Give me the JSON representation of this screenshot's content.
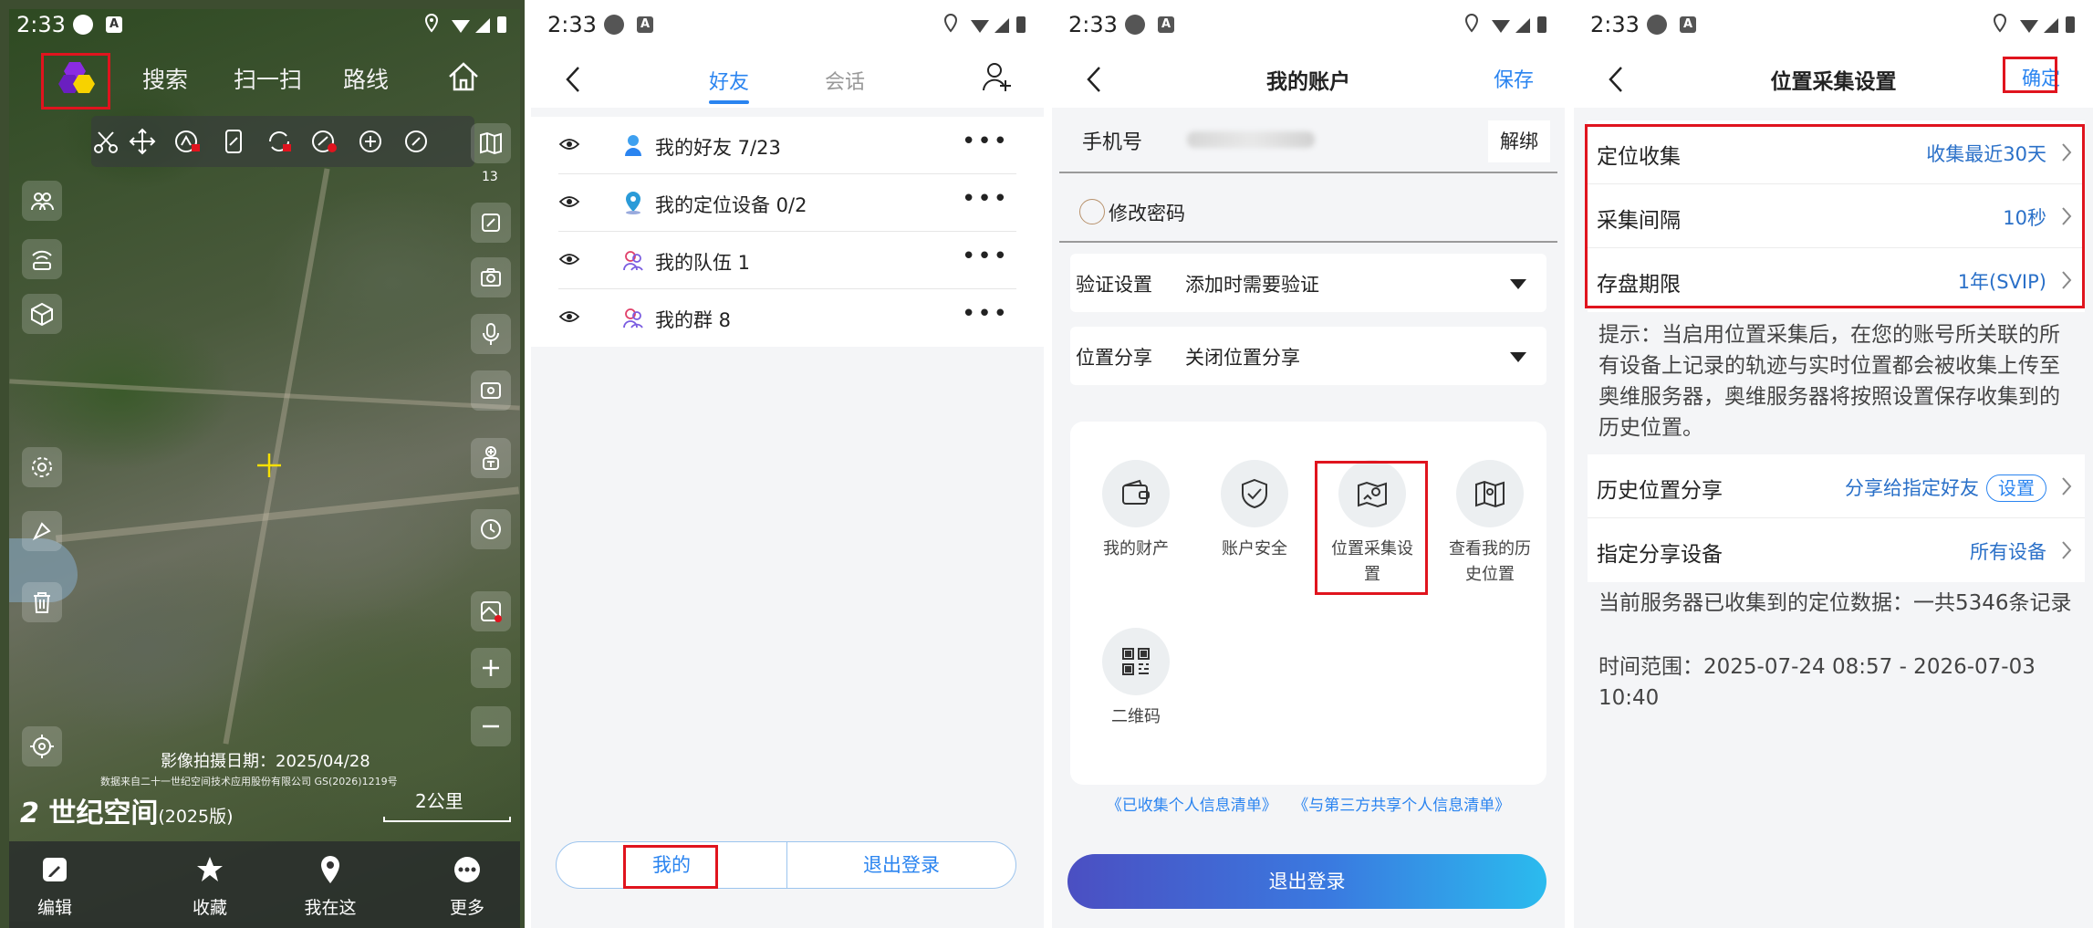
{
  "status_bar": {
    "time": "2:33"
  },
  "map_panel": {
    "nav": {
      "search": "搜索",
      "scan": "扫一扫",
      "route": "路线"
    },
    "zoom_level": "13",
    "capture_date": "影像拍摄日期：2025/04/28",
    "data_source": "数据来自二十一世纪空间技术应用股份有限公司 GS(2026)1219号",
    "logo": "世纪空间",
    "edition": "(2025版)",
    "scale": "2公里",
    "bottom_nav": {
      "edit": "编辑",
      "favorites": "收藏",
      "here": "我在这",
      "more": "更多"
    }
  },
  "friends_panel": {
    "tabs": {
      "friends": "好友",
      "chats": "会话"
    },
    "items": [
      {
        "label": "我的好友 7/23"
      },
      {
        "label": "我的定位设备 0/2"
      },
      {
        "label": "我的队伍 1"
      },
      {
        "label": "我的群 8"
      }
    ],
    "more_glyph": "•••",
    "bottom": {
      "mine": "我的",
      "logout": "退出登录"
    }
  },
  "account_panel": {
    "title": "我的账户",
    "save": "保存",
    "phone_label": "手机号",
    "unbind": "解绑",
    "change_password": "修改密码",
    "verify": {
      "label": "验证设置",
      "value": "添加时需要验证"
    },
    "location_share": {
      "label": "位置分享",
      "value": "关闭位置分享"
    },
    "grid": {
      "assets": "我的财产",
      "security": "账户安全",
      "collect_line1": "位置采集设",
      "collect_line2": "置",
      "history_line1": "查看我的历",
      "history_line2": "史位置",
      "qrcode": "二维码"
    },
    "links": {
      "collected": "《已收集个人信息清单》",
      "shared": "《与第三方共享个人信息清单》"
    },
    "logout": "退出登录"
  },
  "settings_panel": {
    "title": "位置采集设置",
    "confirm": "确定",
    "rows": [
      {
        "label": "定位收集",
        "value": "收集最近30天"
      },
      {
        "label": "采集间隔",
        "value": "10秒"
      },
      {
        "label": "存盘期限",
        "value": "1年(SVIP)"
      }
    ],
    "tip": "提示：当启用位置采集后，在您的账号所关联的所有设备上记录的轨迹与实时位置都会被收集上传至奥维服务器，奥维服务器将按照设置保存收集到的历史位置。",
    "history_share": {
      "label": "历史位置分享",
      "value": "分享给指定好友",
      "button": "设置"
    },
    "share_device": {
      "label": "指定分享设备",
      "value": "所有设备"
    },
    "server_summary": "当前服务器已收集到的定位数据：一共5346条记录",
    "time_range": "时间范围：2025-07-24 08:57 - 2026-07-03 10:40"
  },
  "colors": {
    "accent": "#2a84f0",
    "highlight": "#e0141e"
  }
}
